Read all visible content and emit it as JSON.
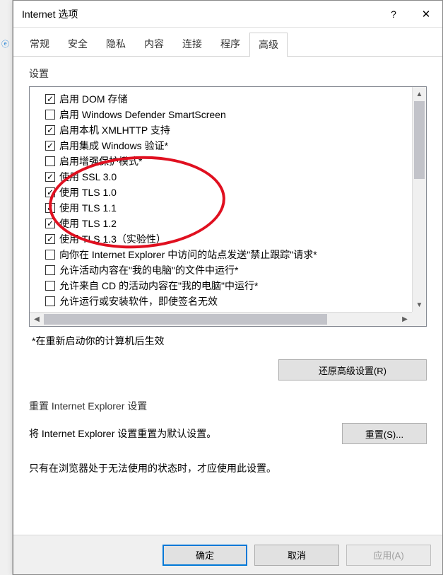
{
  "dialog": {
    "title": "Internet 选项",
    "help_symbol": "?",
    "close_symbol": "✕"
  },
  "tabs": {
    "items": [
      {
        "label": "常规"
      },
      {
        "label": "安全"
      },
      {
        "label": "隐私"
      },
      {
        "label": "内容"
      },
      {
        "label": "连接"
      },
      {
        "label": "程序"
      },
      {
        "label": "高级"
      }
    ],
    "active_index": 6
  },
  "settings": {
    "label": "设置",
    "restart_note": "*在重新启动你的计算机后生效",
    "restore_button": "还原高级设置(R)",
    "items": [
      {
        "checked": true,
        "label": "启用 DOM 存储"
      },
      {
        "checked": false,
        "label": "启用 Windows Defender SmartScreen"
      },
      {
        "checked": true,
        "label": "启用本机 XMLHTTP 支持"
      },
      {
        "checked": true,
        "label": "启用集成 Windows 验证*"
      },
      {
        "checked": false,
        "label": "启用增强保护模式*"
      },
      {
        "checked": true,
        "label": "使用 SSL 3.0"
      },
      {
        "checked": true,
        "label": "使用 TLS 1.0"
      },
      {
        "checked": true,
        "label": "使用 TLS 1.1"
      },
      {
        "checked": true,
        "label": "使用 TLS 1.2"
      },
      {
        "checked": true,
        "label": "使用 TLS 1.3（实验性）"
      },
      {
        "checked": false,
        "label": "向你在 Internet Explorer 中访问的站点发送\"禁止跟踪\"请求*"
      },
      {
        "checked": false,
        "label": "允许活动内容在\"我的电脑\"的文件中运行*"
      },
      {
        "checked": false,
        "label": "允许来自 CD 的活动内容在\"我的电脑\"中运行*"
      },
      {
        "checked": false,
        "label": "允许运行或安装软件，即使签名无效"
      }
    ]
  },
  "reset": {
    "section_label": "重置 Internet Explorer 设置",
    "desc": "将 Internet Explorer 设置重置为默认设置。",
    "button": "重置(S)...",
    "note": "只有在浏览器处于无法使用的状态时，才应使用此设置。"
  },
  "footer": {
    "ok": "确定",
    "cancel": "取消",
    "apply": "应用(A)"
  },
  "annotation": {
    "color": "#e01020",
    "shape": "ellipse",
    "highlights_rows": [
      5,
      6,
      7,
      8,
      9
    ]
  }
}
